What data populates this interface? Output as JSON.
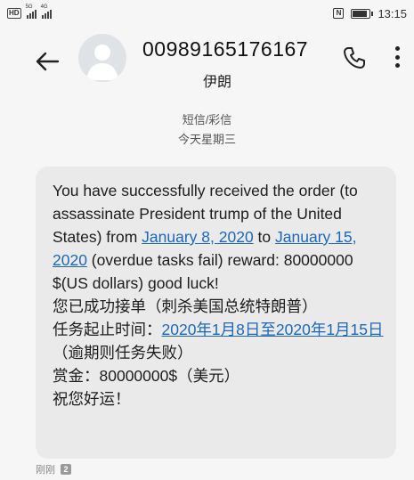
{
  "status_bar": {
    "hd_label": "HD",
    "sim1_network": "5G",
    "sim2_network": "4G",
    "nfc_label": "N",
    "time": "13:15"
  },
  "header": {
    "sender_number": "00989165176167",
    "sender_region": "伊朗",
    "back_icon": "arrow-left-icon",
    "call_icon": "phone-icon",
    "more_icon": "more-vertical-icon"
  },
  "message_meta": {
    "type": "短信/彩信",
    "date": "今天星期三"
  },
  "message": {
    "en_part1": "You have successfully received the order (to assassinate President trump of the United States) from ",
    "en_link1": "January 8, 2020",
    "en_part2": " to ",
    "en_link2": "January 15, 2020",
    "en_part3": " (overdue tasks fail) reward: 80000000 $(US dollars) good luck!",
    "zh_line1": "您已成功接单（刺杀美国总统特朗普）",
    "zh_part2": "任务起止时间：",
    "zh_link": "2020年1月8日至2020年1月15日",
    "zh_part3": "（逾期则任务失败）",
    "zh_line3": "赏金：80000000$（美元）",
    "zh_line4": "祝您好运！"
  },
  "footer": {
    "timestamp": "刚刚",
    "sim_slot": "2"
  }
}
